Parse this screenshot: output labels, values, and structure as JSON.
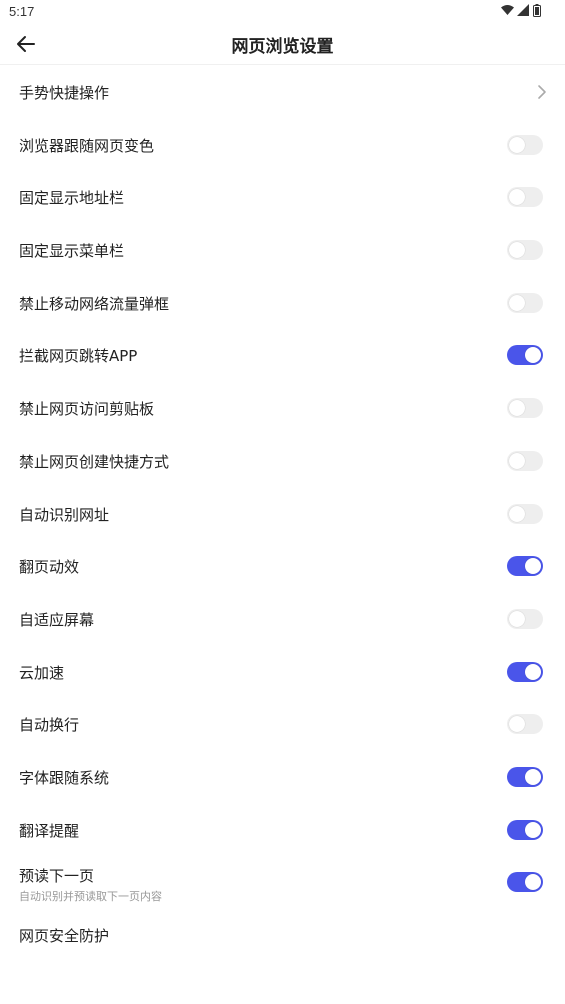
{
  "status_bar": {
    "time": "5:17",
    "icons": [
      "wifi-icon",
      "signal-icon",
      "battery-icon"
    ]
  },
  "header": {
    "title": "网页浏览设置",
    "back_icon": "back-arrow-icon"
  },
  "accent_color": "#4a55ea",
  "items": [
    {
      "label": "手势快捷操作",
      "control": "chevron"
    },
    {
      "label": "浏览器跟随网页变色",
      "control": "toggle",
      "on": false
    },
    {
      "label": "固定显示地址栏",
      "control": "toggle",
      "on": false
    },
    {
      "label": "固定显示菜单栏",
      "control": "toggle",
      "on": false
    },
    {
      "label": "禁止移动网络流量弹框",
      "control": "toggle",
      "on": false
    },
    {
      "label": "拦截网页跳转APP",
      "control": "toggle",
      "on": true
    },
    {
      "label": "禁止网页访问剪贴板",
      "control": "toggle",
      "on": false
    },
    {
      "label": "禁止网页创建快捷方式",
      "control": "toggle",
      "on": false
    },
    {
      "label": "自动识别网址",
      "control": "toggle",
      "on": false
    },
    {
      "label": "翻页动效",
      "control": "toggle",
      "on": true
    },
    {
      "label": "自适应屏幕",
      "control": "toggle",
      "on": false
    },
    {
      "label": "云加速",
      "control": "toggle",
      "on": true
    },
    {
      "label": "自动换行",
      "control": "toggle",
      "on": false
    },
    {
      "label": "字体跟随系统",
      "control": "toggle",
      "on": true
    },
    {
      "label": "翻译提醒",
      "control": "toggle",
      "on": true
    },
    {
      "label": "预读下一页",
      "sublabel": "自动识别并预读取下一页内容",
      "control": "toggle",
      "on": true
    },
    {
      "label": "网页安全防护",
      "control": "none"
    }
  ]
}
